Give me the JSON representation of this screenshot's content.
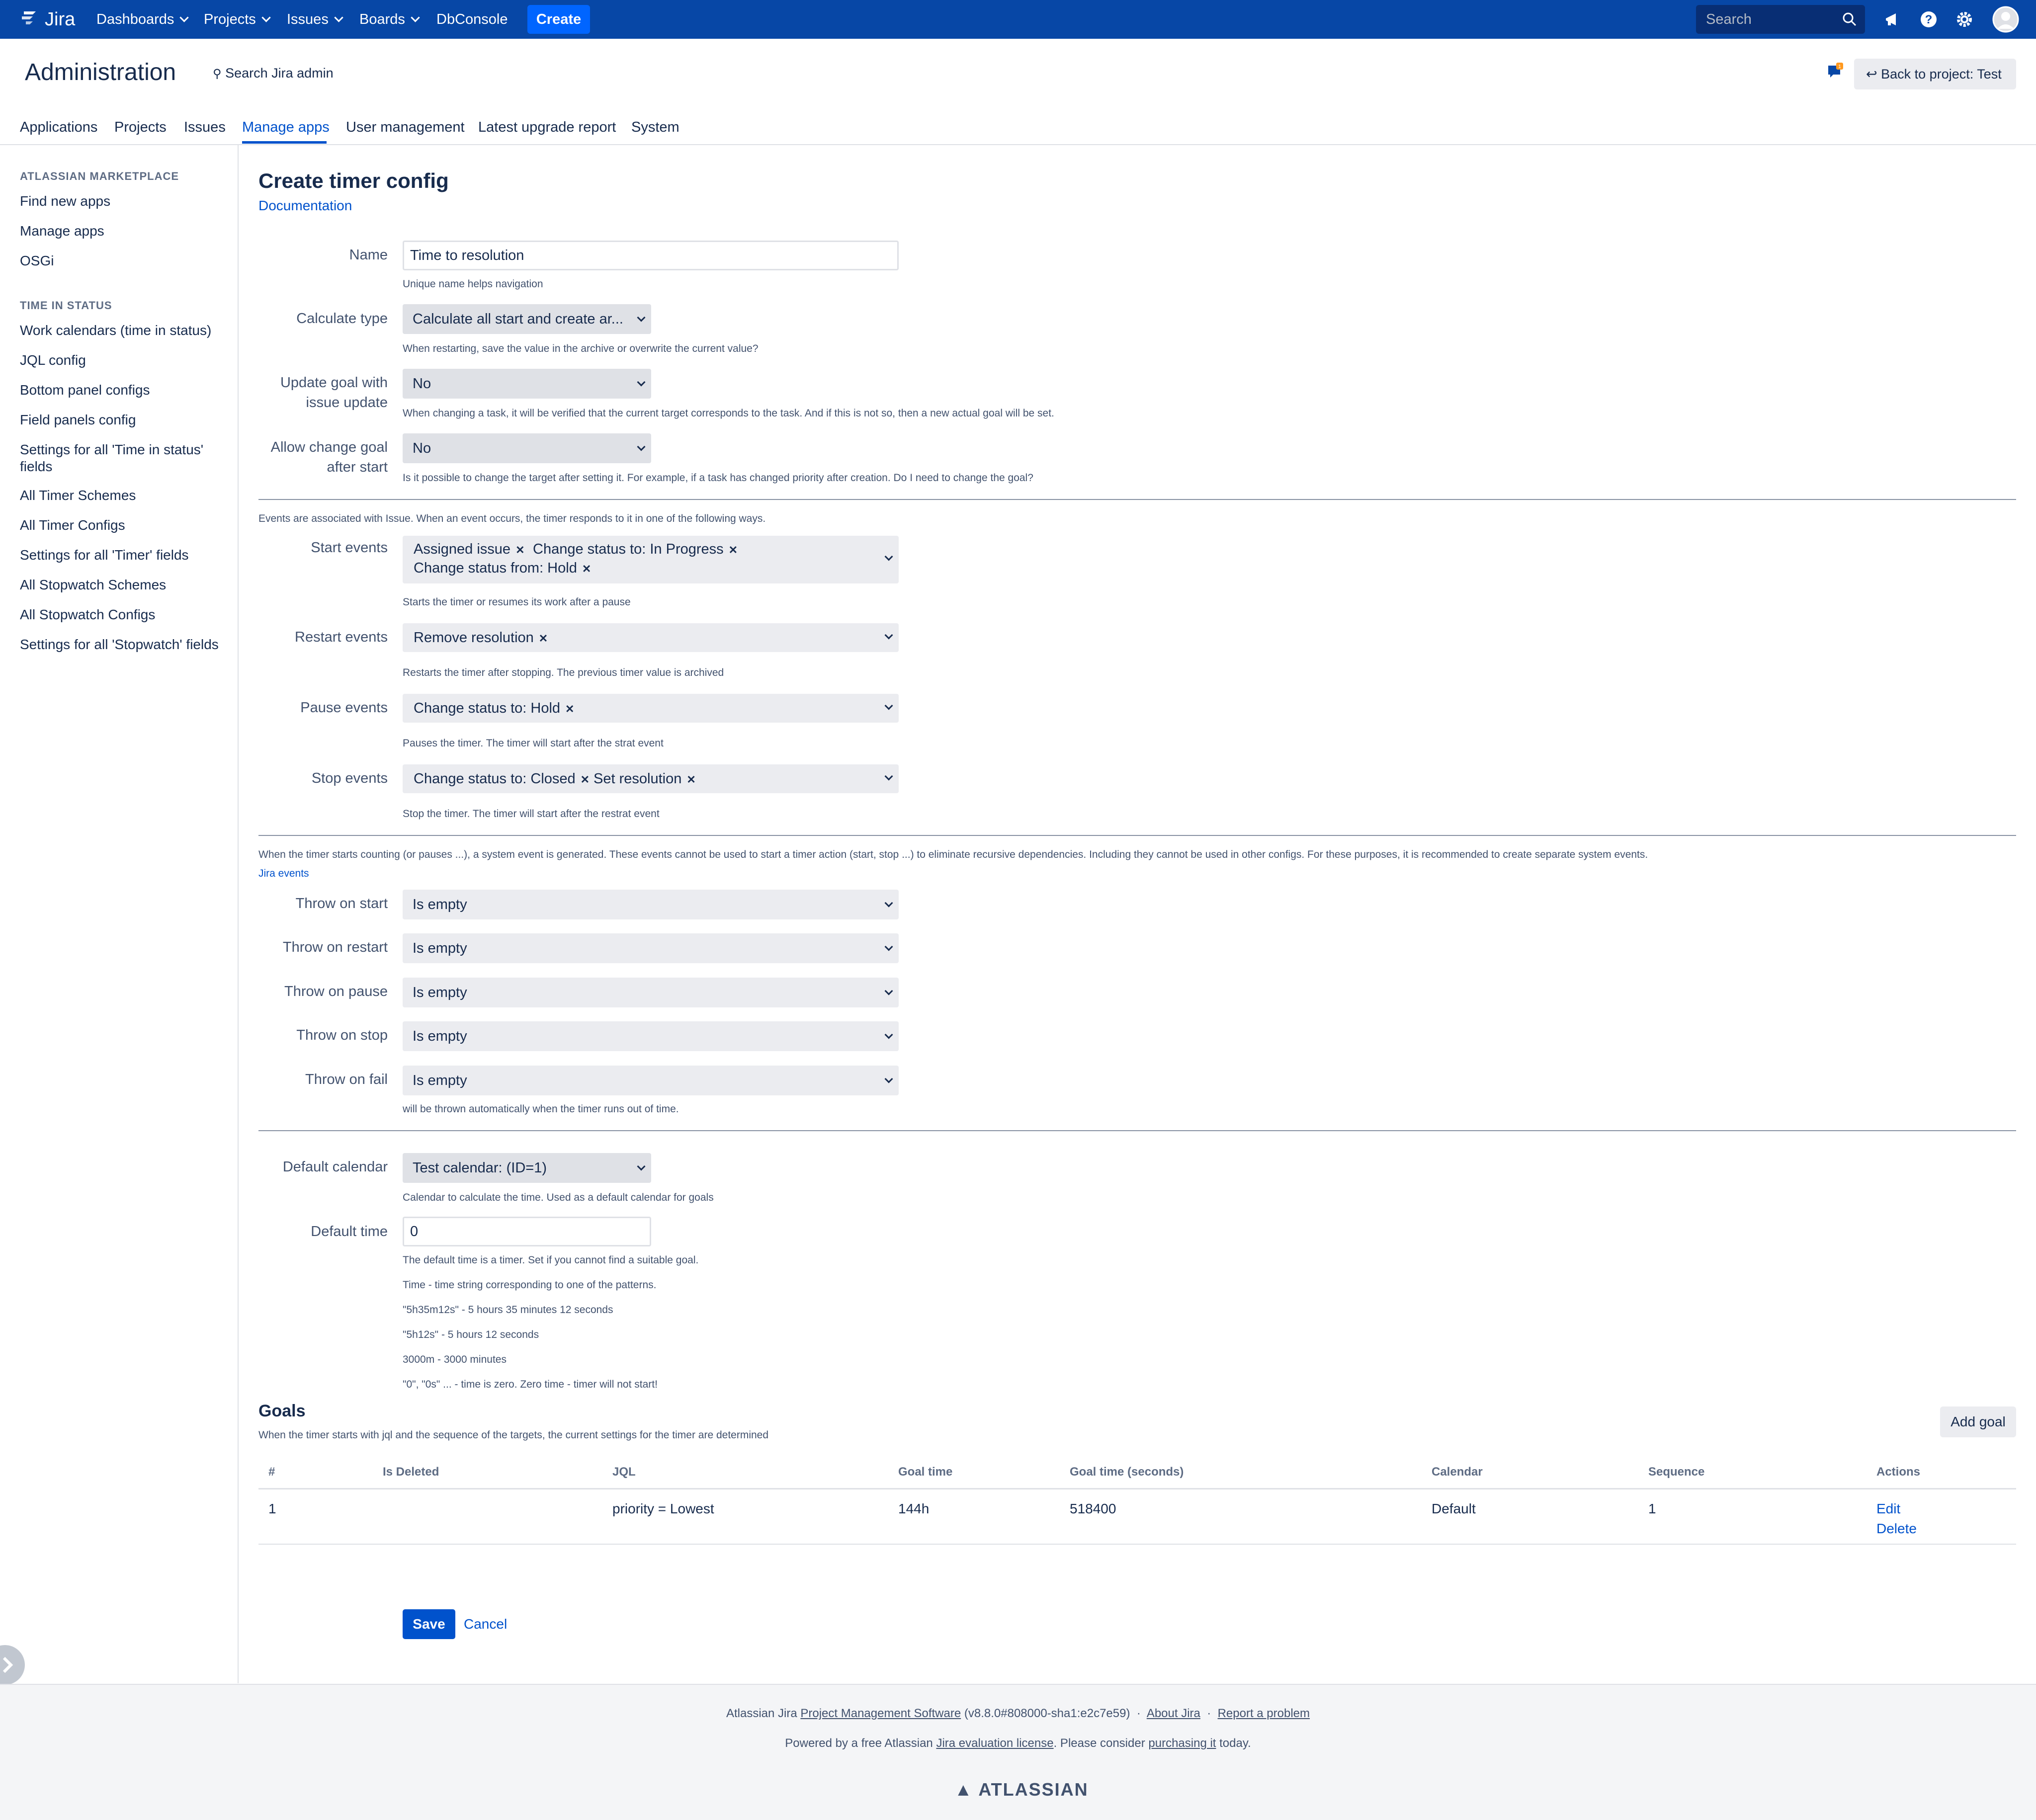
{
  "topnav": {
    "logo_text": "Jira",
    "items": [
      {
        "label": "Dashboards"
      },
      {
        "label": "Projects"
      },
      {
        "label": "Issues"
      },
      {
        "label": "Boards"
      },
      {
        "label": "DbConsole"
      }
    ],
    "create_label": "Create",
    "search_placeholder": "Search",
    "icons": [
      "notifications-icon",
      "help-icon",
      "settings-icon",
      "avatar"
    ],
    "bg_color": "#0747a6",
    "create_color": "#0065ff"
  },
  "header": {
    "title": "Administration",
    "search_label": "Search Jira admin",
    "back_label": "Back to project: Test",
    "notification_count": "1"
  },
  "tabs": [
    {
      "label": "Applications"
    },
    {
      "label": "Projects"
    },
    {
      "label": "Issues"
    },
    {
      "label": "Manage apps",
      "active": true
    },
    {
      "label": "User management"
    },
    {
      "label": "Latest upgrade report"
    },
    {
      "label": "System"
    }
  ],
  "sidebar": {
    "section1_heading": "ATLASSIAN MARKETPLACE",
    "section1_items": [
      "Find new apps",
      "Manage apps",
      "OSGi"
    ],
    "section2_heading": "TIME IN STATUS",
    "section2_items": [
      "Work calendars (time in status)",
      "JQL config",
      "Bottom panel configs",
      "Field panels config",
      "Settings for all 'Time in status' fields",
      "All Timer Schemes",
      "All Timer Configs",
      "Settings for all 'Timer' fields",
      "All Stopwatch Schemes",
      "All Stopwatch Configs",
      "Settings for all 'Stopwatch' fields"
    ]
  },
  "form": {
    "title": "Create timer config",
    "doc_link": "Documentation",
    "name": {
      "label": "Name",
      "value": "Time to resolution",
      "help": "Unique name helps navigation"
    },
    "calc_type": {
      "label": "Calculate type",
      "value": "Calculate all start and create ar...",
      "help": "When restarting, save the value in the archive or overwrite the current value?"
    },
    "update_goal": {
      "label1": "Update goal with",
      "label2": "issue update",
      "value": "No",
      "help": "When changing a task, it will be verified that the current target corresponds to the task. And if this is not so, then a new actual goal will be set."
    },
    "allow_change": {
      "label1": "Allow change goal",
      "label2": "after start",
      "value": "No",
      "help": "Is it possible to change the target after setting it. For example, if a task has changed priority after creation. Do I need to change the goal?"
    },
    "events_note": "Events are associated with Issue. When an event occurs, the timer responds to it in one of the following ways.",
    "start_events": {
      "label": "Start events",
      "tags": [
        "Assigned issue",
        "Change status to: In Progress",
        "Change status from: Hold"
      ],
      "help": "Starts the timer or resumes its work after a pause"
    },
    "restart_events": {
      "label": "Restart events",
      "tags": [
        "Remove resolution"
      ],
      "help": "Restarts the timer after stopping. The previous timer value is archived"
    },
    "pause_events": {
      "label": "Pause events",
      "tags": [
        "Change status to: Hold"
      ],
      "help": "Pauses the timer. The timer will start after the strat event"
    },
    "stop_events": {
      "label": "Stop events",
      "tags": [
        "Change status to: Closed",
        "Set resolution"
      ],
      "help": "Stop the timer. The timer will start after the restrat event"
    },
    "system_note": "When the timer starts counting (or pauses ...), a system event is generated. These events cannot be used to start a timer action (start, stop ...) to eliminate recursive dependencies. Including they cannot be used in other configs. For these purposes, it is recommended to create separate system events.",
    "jira_events_link": "Jira events",
    "throw": [
      {
        "label": "Throw on start",
        "value": "Is empty"
      },
      {
        "label": "Throw on restart",
        "value": "Is empty"
      },
      {
        "label": "Throw on pause",
        "value": "Is empty"
      },
      {
        "label": "Throw on stop",
        "value": "Is empty"
      },
      {
        "label": "Throw on fail",
        "value": "Is empty"
      }
    ],
    "throw_help": "will be thrown automatically when the timer runs out of time.",
    "default_calendar": {
      "label": "Default calendar",
      "value": "Test calendar: (ID=1)",
      "help": "Calendar to calculate the time. Used as a default calendar for goals"
    },
    "default_time": {
      "label": "Default time",
      "value": "0",
      "help": [
        "The default time is a timer. Set if you cannot find a suitable goal.",
        "Time - time string corresponding to one of the patterns.",
        "\"5h35m12s\" - 5 hours 35 minutes 12 seconds",
        "\"5h12s\" - 5 hours 12 seconds",
        "3000m - 3000 minutes",
        "\"0\", \"0s\" ... - time is zero. Zero time - timer will not start!"
      ]
    }
  },
  "goals": {
    "title": "Goals",
    "add_label": "Add goal",
    "description": "When the timer starts with jql and the sequence of the targets, the current settings for the timer are determined",
    "columns": [
      "#",
      "Is Deleted",
      "JQL",
      "Goal time",
      "Goal time (seconds)",
      "Calendar",
      "Sequence",
      "Actions"
    ],
    "rows": [
      {
        "num": "1",
        "is_deleted": "",
        "jql": "priority = Lowest",
        "goal_time": "144h",
        "goal_seconds": "518400",
        "calendar": "Default",
        "sequence": "1",
        "edit": "Edit",
        "delete": "Delete"
      }
    ]
  },
  "buttons": {
    "save": "Save",
    "cancel": "Cancel"
  },
  "footer": {
    "line1_prefix": "Atlassian Jira",
    "line1_link1": "Project Management Software",
    "line1_version": "(v8.8.0#808000-sha1:e2c7e59)",
    "line1_sep": "·",
    "line1_link2": "About Jira",
    "line1_link3": "Report a problem",
    "line2_prefix": "Powered by a free Atlassian",
    "line2_link1": "Jira evaluation license",
    "line2_mid": ". Please consider",
    "line2_link2": "purchasing it",
    "line2_suffix": "today.",
    "logo": "ATLASSIAN"
  }
}
